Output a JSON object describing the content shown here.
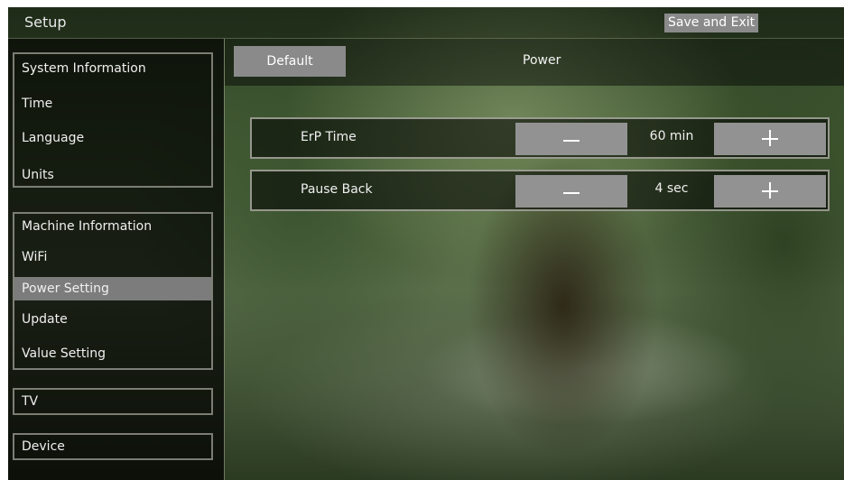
{
  "header": {
    "title": "Setup",
    "save_exit_label": "Save and Exit"
  },
  "sidebar": {
    "group1": [
      "System Information",
      "Time",
      "Language",
      "Units"
    ],
    "group2": [
      "Machine Information",
      "WiFi",
      "Power Setting",
      "Update",
      "Value Setting"
    ],
    "group3": [
      "TV"
    ],
    "group4": [
      "Device"
    ],
    "selected": "Power Setting"
  },
  "panel": {
    "default_label": "Default",
    "title": "Power",
    "rows": [
      {
        "label": "ErP Time",
        "value": "60 min"
      },
      {
        "label": "Pause Back",
        "value": "4 sec"
      }
    ]
  },
  "colors": {
    "button_gray": "#8a8a8a",
    "selected_gray": "#7c7c7c"
  },
  "icons": {
    "decrement": "minus-icon",
    "increment": "plus-icon"
  }
}
